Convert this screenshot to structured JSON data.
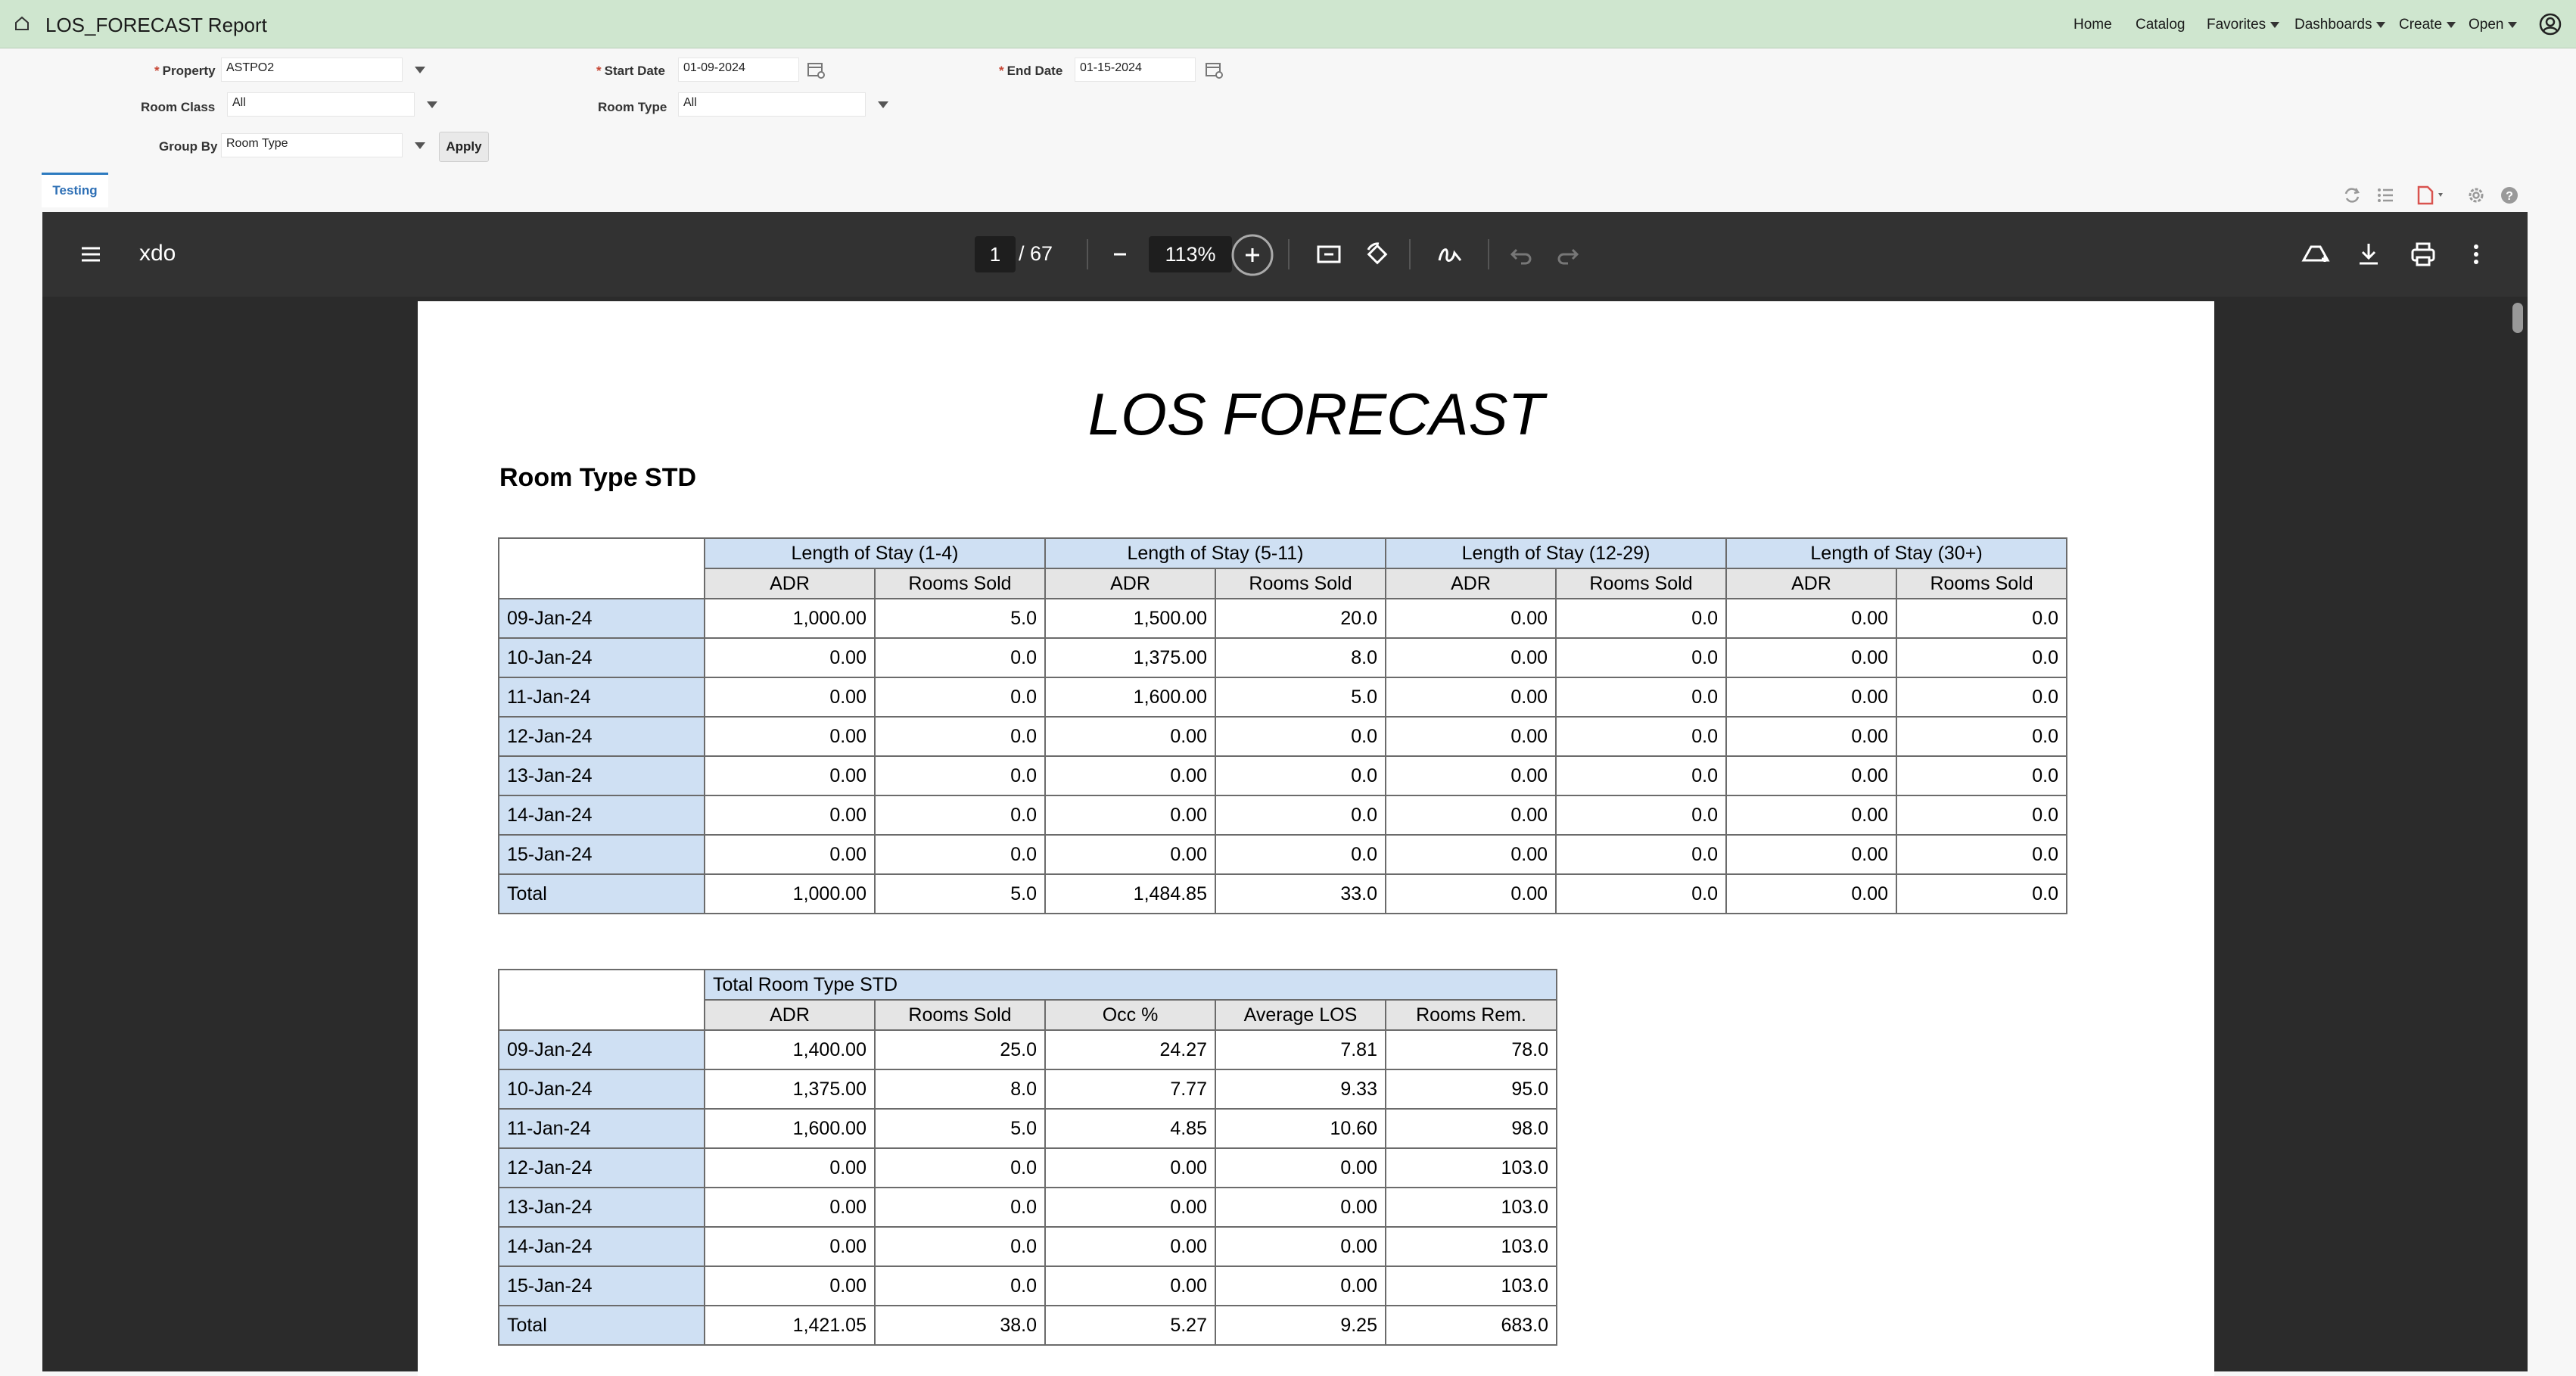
{
  "app": {
    "title": "LOS_FORECAST Report"
  },
  "topnav": {
    "home": "Home",
    "catalog": "Catalog",
    "favorites": "Favorites",
    "dashboards": "Dashboards",
    "create": "Create",
    "open": "Open"
  },
  "params": {
    "property_label": "Property",
    "property_value": "ASTPO2",
    "start_date_label": "Start Date",
    "start_date_value": "01-09-2024",
    "end_date_label": "End Date",
    "end_date_value": "01-15-2024",
    "room_class_label": "Room Class",
    "room_class_value": "All",
    "room_type_label": "Room Type",
    "room_type_value": "All",
    "group_by_label": "Group By",
    "group_by_value": "Room Type",
    "apply_label": "Apply",
    "required_mark": "*"
  },
  "tab": {
    "label": "Testing"
  },
  "viewer": {
    "doc_name": "xdo",
    "page_current": "1",
    "page_total": "/ 67",
    "zoom": "113%"
  },
  "report": {
    "title": "LOS FORECAST",
    "section": "Room Type STD",
    "los_table": {
      "groups": [
        "Length of Stay (1-4)",
        "Length of Stay (5-11)",
        "Length of Stay (12-29)",
        "Length of Stay (30+)"
      ],
      "subheaders": [
        "ADR",
        "Rooms Sold"
      ],
      "rows": [
        {
          "date": "09-Jan-24",
          "values": [
            "1,000.00",
            "5.0",
            "1,500.00",
            "20.0",
            "0.00",
            "0.0",
            "0.00",
            "0.0"
          ]
        },
        {
          "date": "10-Jan-24",
          "values": [
            "0.00",
            "0.0",
            "1,375.00",
            "8.0",
            "0.00",
            "0.0",
            "0.00",
            "0.0"
          ]
        },
        {
          "date": "11-Jan-24",
          "values": [
            "0.00",
            "0.0",
            "1,600.00",
            "5.0",
            "0.00",
            "0.0",
            "0.00",
            "0.0"
          ]
        },
        {
          "date": "12-Jan-24",
          "values": [
            "0.00",
            "0.0",
            "0.00",
            "0.0",
            "0.00",
            "0.0",
            "0.00",
            "0.0"
          ]
        },
        {
          "date": "13-Jan-24",
          "values": [
            "0.00",
            "0.0",
            "0.00",
            "0.0",
            "0.00",
            "0.0",
            "0.00",
            "0.0"
          ]
        },
        {
          "date": "14-Jan-24",
          "values": [
            "0.00",
            "0.0",
            "0.00",
            "0.0",
            "0.00",
            "0.0",
            "0.00",
            "0.0"
          ]
        },
        {
          "date": "15-Jan-24",
          "values": [
            "0.00",
            "0.0",
            "0.00",
            "0.0",
            "0.00",
            "0.0",
            "0.00",
            "0.0"
          ]
        },
        {
          "date": "Total",
          "values": [
            "1,000.00",
            "5.0",
            "1,484.85",
            "33.0",
            "0.00",
            "0.0",
            "0.00",
            "0.0"
          ]
        }
      ]
    },
    "total_table": {
      "group": "Total Room Type STD",
      "headers": [
        "ADR",
        "Rooms Sold",
        "Occ %",
        "Average LOS",
        "Rooms Rem."
      ],
      "rows": [
        {
          "date": "09-Jan-24",
          "values": [
            "1,400.00",
            "25.0",
            "24.27",
            "7.81",
            "78.0"
          ]
        },
        {
          "date": "10-Jan-24",
          "values": [
            "1,375.00",
            "8.0",
            "7.77",
            "9.33",
            "95.0"
          ]
        },
        {
          "date": "11-Jan-24",
          "values": [
            "1,600.00",
            "5.0",
            "4.85",
            "10.60",
            "98.0"
          ]
        },
        {
          "date": "12-Jan-24",
          "values": [
            "0.00",
            "0.0",
            "0.00",
            "0.00",
            "103.0"
          ]
        },
        {
          "date": "13-Jan-24",
          "values": [
            "0.00",
            "0.0",
            "0.00",
            "0.00",
            "103.0"
          ]
        },
        {
          "date": "14-Jan-24",
          "values": [
            "0.00",
            "0.0",
            "0.00",
            "0.00",
            "103.0"
          ]
        },
        {
          "date": "15-Jan-24",
          "values": [
            "0.00",
            "0.0",
            "0.00",
            "0.00",
            "103.0"
          ]
        },
        {
          "date": "Total",
          "values": [
            "1,421.05",
            "38.0",
            "5.27",
            "9.25",
            "683.0"
          ]
        }
      ]
    }
  }
}
